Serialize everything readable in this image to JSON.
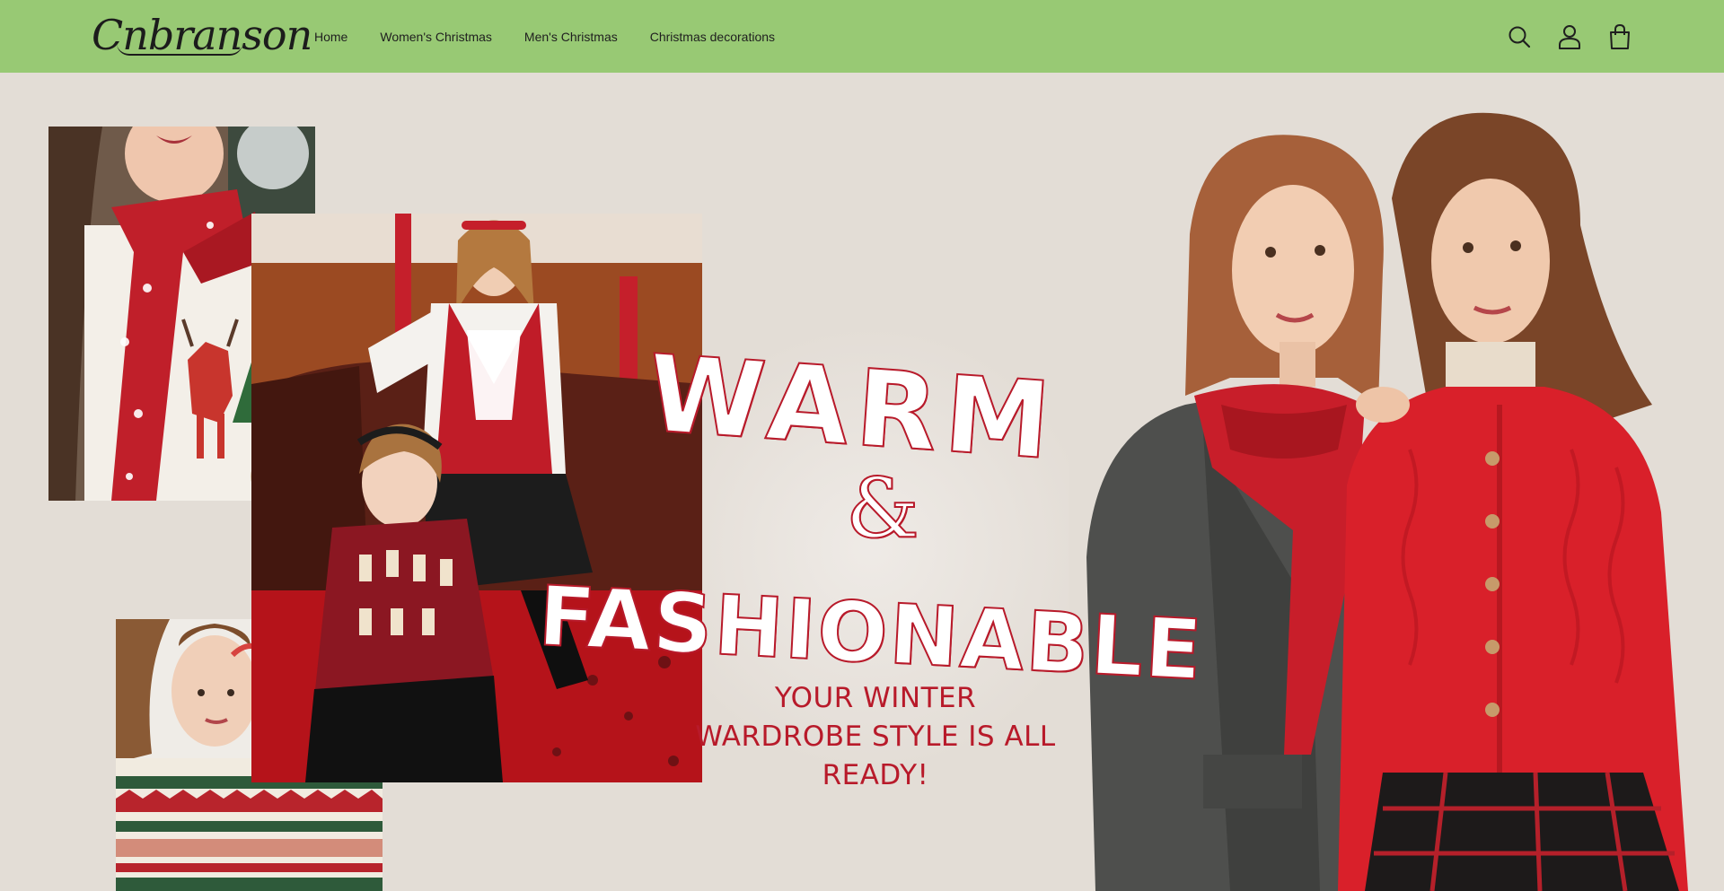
{
  "brand": {
    "logo_text": "Cnbranson"
  },
  "nav": {
    "items": [
      {
        "label": "Home"
      },
      {
        "label": "Women's Christmas"
      },
      {
        "label": "Men's Christmas"
      },
      {
        "label": "Christmas decorations"
      }
    ]
  },
  "header_icons": [
    "search-icon",
    "account-icon",
    "cart-bag-icon"
  ],
  "hero": {
    "headline_line1": "WARM",
    "headline_line2": "&",
    "headline_line3": "FASHIONABLE",
    "subline": [
      "YOUR WINTER",
      "WARDROBE STYLE IS ALL",
      "READY!"
    ]
  },
  "colors": {
    "header_bg": "#98c974",
    "page_bg": "#e3ddd6",
    "accent_red": "#b81a2a",
    "headline_fill": "#ffffff"
  }
}
